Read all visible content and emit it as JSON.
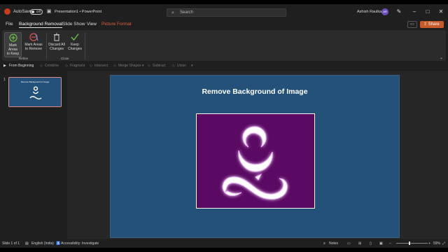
{
  "titlebar": {
    "autosave_label": "AutoSave",
    "autosave_state": "Off",
    "doc_title": "Presentation1 • PowerPoint",
    "search_placeholder": "Search",
    "user_name": "Ashish Raulkar",
    "user_initials": "AR"
  },
  "tabs": [
    {
      "label": "File"
    },
    {
      "label": "Background Removal"
    },
    {
      "label": "Slide Show"
    },
    {
      "label": "View"
    },
    {
      "label": "Picture Format"
    }
  ],
  "share_label": "Share",
  "ribbon": {
    "buttons": [
      {
        "label": "Mark Areas to Keep",
        "line1": "Mark Areas",
        "line2": "to Keep"
      },
      {
        "label": "Mark Areas to Remove",
        "line1": "Mark Areas",
        "line2": "to Remove"
      },
      {
        "label": "Discard All Changes",
        "line1": "Discard All",
        "line2": "Changes"
      },
      {
        "label": "Keep Changes",
        "line1": "Keep",
        "line2": "Changes"
      }
    ],
    "groups": [
      {
        "label": "Refine"
      },
      {
        "label": "Close"
      }
    ]
  },
  "quick_toolbar": {
    "items": [
      {
        "label": "From Beginning"
      },
      {
        "label": "Combine"
      },
      {
        "label": "Fragment"
      },
      {
        "label": "Intersect"
      },
      {
        "label": "Merge Shapes"
      },
      {
        "label": "Subtract"
      },
      {
        "label": "Union"
      }
    ]
  },
  "thumbnails": [
    {
      "number": "1",
      "title": "Remove Background of Image"
    }
  ],
  "slide": {
    "title": "Remove Background of Image"
  },
  "status": {
    "slide_info": "Slide 1 of 1",
    "language": "English (India)",
    "accessibility": "Accessibility: Investigate",
    "notes": "Notes",
    "zoom": "59%"
  },
  "colors": {
    "slide_bg": "#24517a",
    "image_bg": "#5a0a62",
    "accent_orange": "#c55a2b",
    "picture_format_tab": "#e0643b"
  }
}
